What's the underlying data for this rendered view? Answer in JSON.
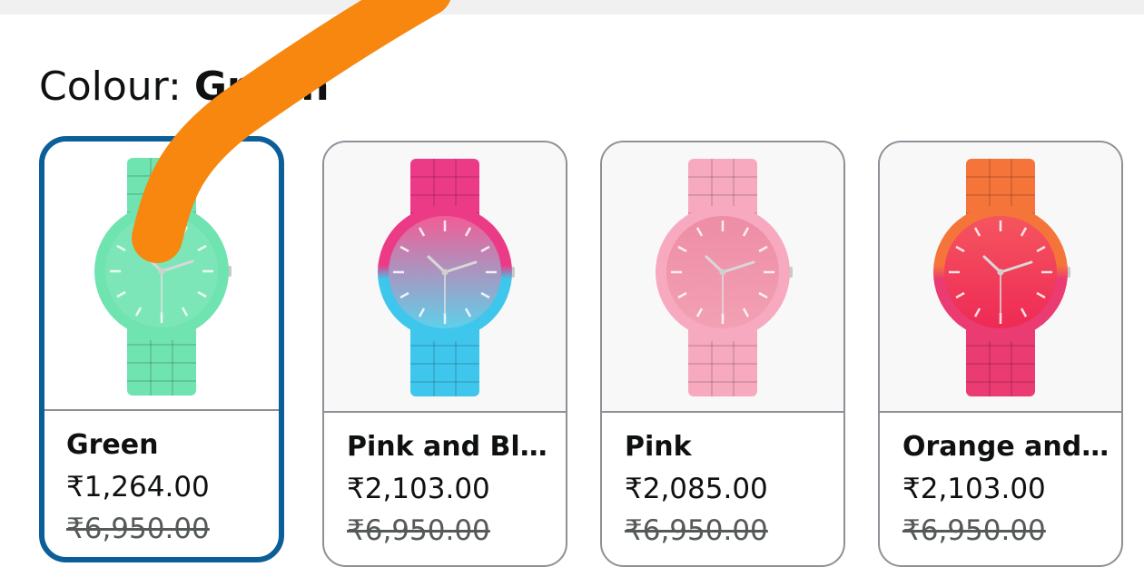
{
  "colour_selector": {
    "label": "Colour: ",
    "selected_value": "Green"
  },
  "swatches": [
    {
      "name": "Green",
      "price": "₹1,264.00",
      "old_price": "₹6,950.00",
      "selected": true,
      "colors": {
        "strap": "#6fe3b0",
        "dial": "#7de6b8",
        "dial_bottom": "#7de6b8"
      }
    },
    {
      "name": "Pink and Blue",
      "price": "₹2,103.00",
      "old_price": "₹6,950.00",
      "selected": false,
      "colors": {
        "strap": "#ec3b86",
        "dial": "#f25c96",
        "dial_bottom": "#5fd0ea",
        "strap_bottom": "#3fc6ec"
      }
    },
    {
      "name": "Pink",
      "price": "₹2,085.00",
      "old_price": "₹6,950.00",
      "selected": false,
      "colors": {
        "strap": "#f7a9bf",
        "dial": "#ee8da6",
        "dial_bottom": "#f2a0b4"
      }
    },
    {
      "name": "Orange and...",
      "price": "₹2,103.00",
      "old_price": "₹6,950.00",
      "selected": false,
      "colors": {
        "strap": "#f5743a",
        "dial": "#f5555f",
        "dial_bottom": "#ee2a55",
        "strap_bottom": "#ea3b73"
      }
    }
  ],
  "theme": {
    "selected_border": "#0b5f99",
    "border": "#8d9096",
    "annotation_stroke": "#f7870e"
  }
}
